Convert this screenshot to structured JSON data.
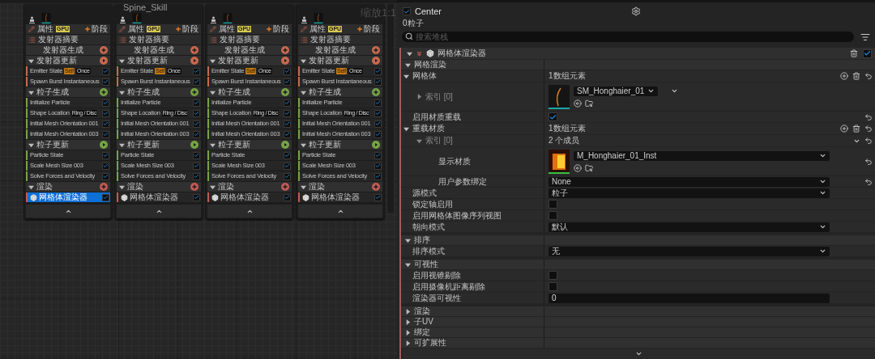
{
  "canvas": {
    "title": "Spine_Skill",
    "zoom_label": "缩放1:1",
    "emitters": [
      {
        "properties": "属性",
        "badge": "GPU",
        "stage_button": "阶段",
        "summary": "发射器摘要",
        "groups": [
          {
            "kind": "spawn",
            "label": "发射器生成",
            "color": "#c8694f"
          },
          {
            "kind": "update",
            "label": "发射器更新",
            "color": "#c8694f",
            "expanded": true,
            "modules": [
              {
                "kind": "module",
                "label": "Emitter State",
                "tags": [
                  {
                    "kind": "scope",
                    "text": "Self"
                  },
                  {
                    "kind": "mode",
                    "text": "Once"
                  }
                ],
                "checked": true,
                "selected": false
              },
              {
                "kind": "module",
                "label": "Spawn Burst Instantaneous",
                "checked": true,
                "selected": false
              }
            ]
          },
          {
            "kind": "spawn",
            "label": "粒子生成",
            "color": "#76a444",
            "expanded": true,
            "modules": [
              {
                "kind": "module",
                "label": "Initialize Particle",
                "checked": true,
                "selected": false
              },
              {
                "kind": "module",
                "label": "Shape Location",
                "tags": [
                  {
                    "kind": "mode",
                    "text": "Ring / Disc"
                  }
                ],
                "checked": true,
                "selected": false
              },
              {
                "kind": "module",
                "label": "Initial Mesh Orientation 001",
                "checked": true,
                "selected": false
              },
              {
                "kind": "module",
                "label": "Initial Mesh Orientation 003",
                "checked": true,
                "selected": false
              }
            ]
          },
          {
            "kind": "update",
            "label": "粒子更新",
            "color": "#76a444",
            "expanded": true,
            "modules": [
              {
                "kind": "module",
                "label": "Particle State",
                "checked": true,
                "selected": false
              },
              {
                "kind": "module",
                "label": "Scale Mesh Size 003",
                "checked": true,
                "selected": false
              },
              {
                "kind": "module",
                "label": "Solve Forces and Velocity",
                "checked": true,
                "selected": false
              }
            ]
          },
          {
            "kind": "render",
            "label": "渲染",
            "color": "#c45a55",
            "expanded": true,
            "modules": [
              {
                "kind": "renderer",
                "label": "网格体渲染器",
                "checked": true,
                "selected": true
              }
            ]
          }
        ]
      },
      {
        "properties": "属性",
        "badge": "GPU",
        "stage_button": "阶段",
        "summary": "发射器摘要",
        "groups": [
          {
            "kind": "spawn",
            "label": "发射器生成",
            "color": "#c8694f"
          },
          {
            "kind": "update",
            "label": "发射器更新",
            "color": "#c8694f",
            "expanded": true,
            "modules": [
              {
                "kind": "module",
                "label": "Emitter State",
                "tags": [
                  {
                    "kind": "scope",
                    "text": "Self"
                  },
                  {
                    "kind": "mode",
                    "text": "Once"
                  }
                ],
                "checked": true,
                "selected": false
              },
              {
                "kind": "module",
                "label": "Spawn Burst Instantaneous",
                "checked": true,
                "selected": false
              }
            ]
          },
          {
            "kind": "spawn",
            "label": "粒子生成",
            "color": "#76a444",
            "expanded": true,
            "modules": [
              {
                "kind": "module",
                "label": "Initialize Particle",
                "checked": true,
                "selected": false
              },
              {
                "kind": "module",
                "label": "Shape Location",
                "tags": [
                  {
                    "kind": "mode",
                    "text": "Ring / Disc"
                  }
                ],
                "checked": true,
                "selected": false
              },
              {
                "kind": "module",
                "label": "Initial Mesh Orientation 001",
                "checked": true,
                "selected": false
              },
              {
                "kind": "module",
                "label": "Initial Mesh Orientation 003",
                "checked": true,
                "selected": false
              }
            ]
          },
          {
            "kind": "update",
            "label": "粒子更新",
            "color": "#76a444",
            "expanded": true,
            "modules": [
              {
                "kind": "module",
                "label": "Particle State",
                "checked": true,
                "selected": false
              },
              {
                "kind": "module",
                "label": "Scale Mesh Size 003",
                "checked": true,
                "selected": false
              },
              {
                "kind": "module",
                "label": "Solve Forces and Velocity",
                "checked": true,
                "selected": false
              }
            ]
          },
          {
            "kind": "render",
            "label": "渲染",
            "color": "#c45a55",
            "expanded": true,
            "modules": [
              {
                "kind": "renderer",
                "label": "网格体渲染器",
                "checked": true,
                "selected": false
              }
            ]
          }
        ]
      },
      {
        "properties": "属性",
        "badge": "GPU",
        "stage_button": "阶段",
        "summary": "发射器摘要",
        "groups": [
          {
            "kind": "spawn",
            "label": "发射器生成",
            "color": "#c8694f"
          },
          {
            "kind": "update",
            "label": "发射器更新",
            "color": "#c8694f",
            "expanded": true,
            "modules": [
              {
                "kind": "module",
                "label": "Emitter State",
                "tags": [
                  {
                    "kind": "scope",
                    "text": "Self"
                  },
                  {
                    "kind": "mode",
                    "text": "Once"
                  }
                ],
                "checked": true,
                "selected": false
              },
              {
                "kind": "module",
                "label": "Spawn Burst Instantaneous",
                "checked": true,
                "selected": false
              }
            ]
          },
          {
            "kind": "spawn",
            "label": "粒子生成",
            "color": "#76a444",
            "expanded": true,
            "modules": [
              {
                "kind": "module",
                "label": "Initialize Particle",
                "checked": true,
                "selected": false
              },
              {
                "kind": "module",
                "label": "Shape Location",
                "tags": [
                  {
                    "kind": "mode",
                    "text": "Ring / Disc"
                  }
                ],
                "checked": true,
                "selected": false
              },
              {
                "kind": "module",
                "label": "Initial Mesh Orientation 001",
                "checked": true,
                "selected": false
              },
              {
                "kind": "module",
                "label": "Initial Mesh Orientation 003",
                "checked": true,
                "selected": false
              }
            ]
          },
          {
            "kind": "update",
            "label": "粒子更新",
            "color": "#76a444",
            "expanded": true,
            "modules": [
              {
                "kind": "module",
                "label": "Particle State",
                "checked": true,
                "selected": false
              },
              {
                "kind": "module",
                "label": "Scale Mesh Size 003",
                "checked": true,
                "selected": false
              },
              {
                "kind": "module",
                "label": "Solve Forces and Velocity",
                "checked": true,
                "selected": false
              }
            ]
          },
          {
            "kind": "render",
            "label": "渲染",
            "color": "#c45a55",
            "expanded": true,
            "modules": [
              {
                "kind": "renderer",
                "label": "网格体渲染器",
                "checked": true,
                "selected": false
              }
            ]
          }
        ]
      },
      {
        "properties": "属性",
        "badge": "GPU",
        "stage_button": "阶段",
        "summary": "发射器摘要",
        "groups": [
          {
            "kind": "spawn",
            "label": "发射器生成",
            "color": "#c8694f"
          },
          {
            "kind": "update",
            "label": "发射器更新",
            "color": "#c8694f",
            "expanded": true,
            "modules": [
              {
                "kind": "module",
                "label": "Emitter State",
                "tags": [
                  {
                    "kind": "scope",
                    "text": "Self"
                  },
                  {
                    "kind": "mode",
                    "text": "Once"
                  }
                ],
                "checked": true,
                "selected": false
              },
              {
                "kind": "module",
                "label": "Spawn Burst Instantaneous",
                "checked": true,
                "selected": false
              }
            ]
          },
          {
            "kind": "spawn",
            "label": "粒子生成",
            "color": "#76a444",
            "expanded": true,
            "modules": [
              {
                "kind": "module",
                "label": "Initialize Particle",
                "checked": true,
                "selected": false
              },
              {
                "kind": "module",
                "label": "Shape Location",
                "tags": [
                  {
                    "kind": "mode",
                    "text": "Ring / Disc"
                  }
                ],
                "checked": true,
                "selected": false
              },
              {
                "kind": "module",
                "label": "Initial Mesh Orientation 001",
                "checked": true,
                "selected": false
              },
              {
                "kind": "module",
                "label": "Initial Mesh Orientation 003",
                "checked": true,
                "selected": false
              }
            ]
          },
          {
            "kind": "update",
            "label": "粒子更新",
            "color": "#76a444",
            "expanded": true,
            "modules": [
              {
                "kind": "module",
                "label": "Particle State",
                "checked": true,
                "selected": false
              },
              {
                "kind": "module",
                "label": "Scale Mesh Size 003",
                "checked": true,
                "selected": false
              },
              {
                "kind": "module",
                "label": "Solve Forces and Velocity",
                "checked": true,
                "selected": false
              }
            ]
          },
          {
            "kind": "render",
            "label": "渲染",
            "color": "#c45a55",
            "expanded": true,
            "modules": [
              {
                "kind": "renderer",
                "label": "网格体渲染器",
                "checked": true,
                "selected": false
              }
            ]
          }
        ]
      }
    ]
  },
  "details": {
    "enabled": true,
    "title": "Center",
    "particle_count": "0粒子",
    "search": {
      "placeholder": "搜索堆栈"
    },
    "renderer": {
      "label": "网格体渲染器",
      "enabled": true,
      "expanded": true
    },
    "categories": [
      {
        "label": "网格渲染",
        "expanded": true,
        "rows": [
          {
            "kind": "array",
            "label": "网格体",
            "expanded": true,
            "value": "1数组元素",
            "modified": true,
            "children": [
              {
                "kind": "mesh_asset",
                "label": "索引 [0]",
                "expanded": false,
                "asset": "SM_Honghaier_01",
                "modified": false
              }
            ]
          },
          {
            "kind": "checkbox",
            "label": "启用材质重载",
            "checked": true,
            "modified": true
          },
          {
            "kind": "array",
            "label": "重载材质",
            "expanded": true,
            "value": "1数组元素",
            "modified": true,
            "children": [
              {
                "kind": "struct",
                "label": "索引 [0]",
                "expanded": true,
                "value": "2 个成员",
                "modified": true,
                "children": [
                  {
                    "kind": "material_asset",
                    "label": "显示材质",
                    "asset": "M_Honghaier_01_Inst",
                    "modified": true
                  },
                  {
                    "kind": "dropdown",
                    "label": "用户参数绑定",
                    "value": "None",
                    "modified": true
                  }
                ]
              }
            ]
          },
          {
            "kind": "dropdown",
            "label": "源模式",
            "value": "粒子",
            "modified": false
          },
          {
            "kind": "checkbox",
            "label": "锁定轴启用",
            "checked": false,
            "modified": false
          },
          {
            "kind": "checkbox",
            "label": "启用网格体图像序列视图",
            "checked": false,
            "modified": false
          },
          {
            "kind": "dropdown",
            "label": "朝向模式",
            "value": "默认",
            "modified": false
          }
        ]
      },
      {
        "label": "排序",
        "expanded": true,
        "rows": [
          {
            "kind": "dropdown",
            "label": "排序模式",
            "value": "无",
            "modified": false
          }
        ]
      },
      {
        "label": "可视性",
        "expanded": true,
        "rows": [
          {
            "kind": "checkbox",
            "label": "启用视锥剔除",
            "checked": false,
            "modified": false
          },
          {
            "kind": "checkbox",
            "label": "启用摄像机距离剔除",
            "checked": false,
            "modified": false
          },
          {
            "kind": "text",
            "label": "渲染器可视性",
            "value": "0",
            "modified": false
          }
        ]
      },
      {
        "label": "渲染",
        "expanded": false
      },
      {
        "label": "子UV",
        "expanded": false
      },
      {
        "label": "绑定",
        "expanded": false
      },
      {
        "label": "可扩展性",
        "expanded": false
      }
    ]
  }
}
